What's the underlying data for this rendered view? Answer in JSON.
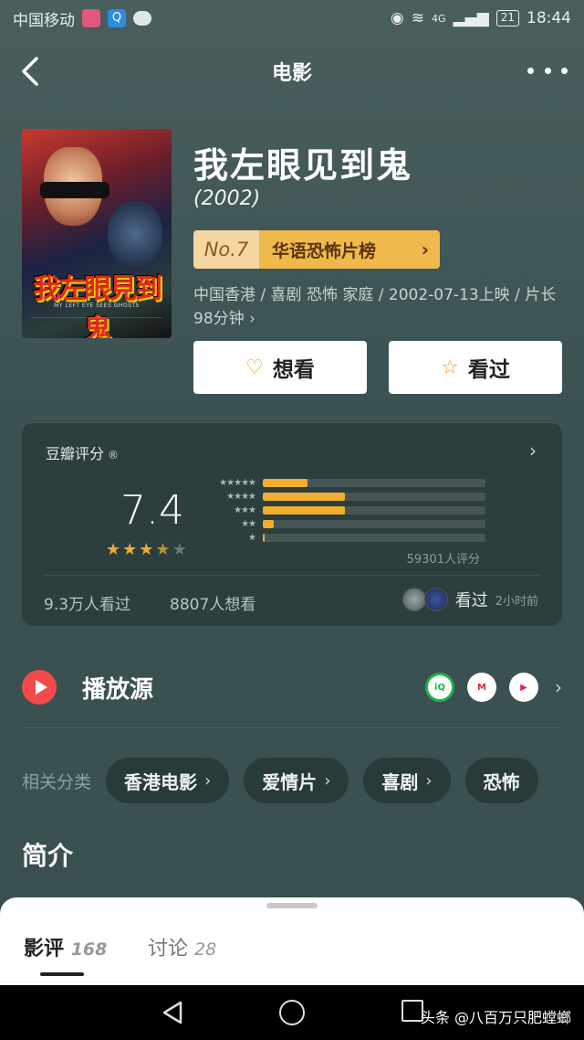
{
  "status_bar": {
    "carrier": "中国移动",
    "network": "4G",
    "battery": "21",
    "time": "18:44"
  },
  "nav": {
    "title": "电影"
  },
  "movie": {
    "poster_title": "我左眼見到鬼",
    "poster_subtitle": "MY LEFT EYE SEES GHOSTS",
    "title": "我左眼见到鬼",
    "year": "(2002)",
    "rank_no": "No.7",
    "rank_list": "华语恐怖片榜",
    "meta_line": "中国香港 / 喜剧 恐怖 家庭 / 2002-07-13上映 / 片长98分钟 ›",
    "want_label": "想看",
    "seen_label": "看过"
  },
  "rating": {
    "label": "豆瓣评分",
    "score": "7.4",
    "stars": 3.5,
    "distribution": [
      {
        "stars": "★★★★★",
        "fraction": 0.2
      },
      {
        "stars": "★★★★",
        "fraction": 0.37
      },
      {
        "stars": "★★★",
        "fraction": 0.37
      },
      {
        "stars": "★★",
        "fraction": 0.05
      },
      {
        "stars": "★",
        "fraction": 0.01
      }
    ],
    "count": "59301人评分",
    "seen_count": "9.3万人看过",
    "want_count": "8807人想看",
    "friends_action": "看过",
    "friends_time": "2小时前"
  },
  "play": {
    "label": "播放源",
    "sources": [
      "iqiyi",
      "mgtv",
      "youku"
    ]
  },
  "categories": {
    "label": "相关分类",
    "items": [
      "香港电影",
      "爱情片",
      "喜剧",
      "恐怖"
    ]
  },
  "intro": {
    "title": "简介"
  },
  "sheet": {
    "tab_review": "影评",
    "tab_review_count": "168",
    "tab_discuss": "讨论",
    "tab_discuss_count": "28"
  },
  "watermark": "头条 @八百万只肥螳螂",
  "colors": {
    "accent": "#f2ad2f",
    "play_red": "#f24a4a",
    "background": "#3c5252"
  }
}
